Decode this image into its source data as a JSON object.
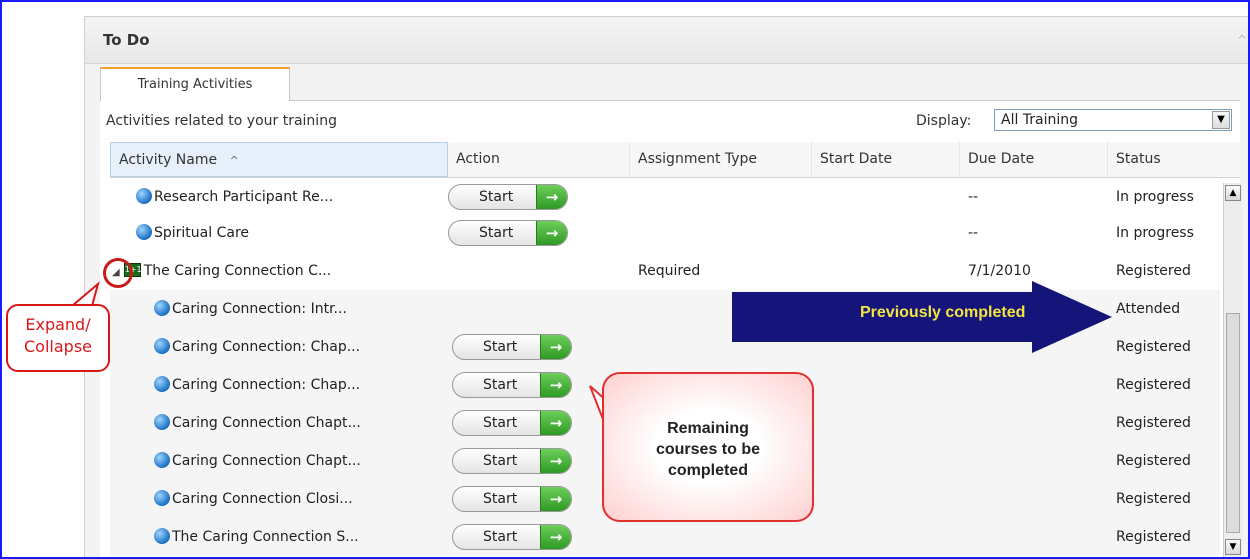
{
  "panel": {
    "title": "To Do",
    "collapse_icon": "^"
  },
  "tabs": [
    {
      "label": "Training Activities"
    }
  ],
  "toolbar": {
    "description": "Activities related to your training",
    "display_label": "Display:",
    "display_value": "All Training"
  },
  "grid": {
    "columns": [
      "Activity Name",
      "Action",
      "Assignment Type",
      "Start Date",
      "Due Date",
      "Status"
    ],
    "sort_indicator": "^",
    "rows": [
      {
        "name": "Research Participant Re...",
        "action": "Start",
        "assignment": "",
        "start": "",
        "due": "--",
        "status": "In progress",
        "icon": "globe-icon",
        "level": 0
      },
      {
        "name": "Spiritual Care",
        "action": "Start",
        "assignment": "",
        "start": "",
        "due": "--",
        "status": "In progress",
        "icon": "globe-icon",
        "level": 0
      },
      {
        "name": "The Caring Connection C...",
        "action": "",
        "assignment": "Required",
        "start": "",
        "due": "7/1/2010",
        "status": "Registered",
        "icon": "curriculum-icon",
        "level": 0,
        "expander": "◢"
      },
      {
        "name": "Caring Connection: Intr...",
        "action": "",
        "assignment": "",
        "start": "",
        "due": "",
        "status": "Attended",
        "icon": "globe-icon",
        "level": 1
      },
      {
        "name": "Caring Connection: Chap...",
        "action": "Start",
        "assignment": "",
        "start": "",
        "due": "",
        "status": "Registered",
        "icon": "globe-icon",
        "level": 1
      },
      {
        "name": "Caring Connection: Chap...",
        "action": "Start",
        "assignment": "",
        "start": "",
        "due": "",
        "status": "Registered",
        "icon": "globe-icon",
        "level": 1
      },
      {
        "name": "Caring Connection Chapt...",
        "action": "Start",
        "assignment": "",
        "start": "",
        "due": "",
        "status": "Registered",
        "icon": "globe-icon",
        "level": 1
      },
      {
        "name": "Caring Connection Chapt...",
        "action": "Start",
        "assignment": "",
        "start": "",
        "due": "",
        "status": "Registered",
        "icon": "globe-icon",
        "level": 1
      },
      {
        "name": "Caring Connection Closi...",
        "action": "Start",
        "assignment": "",
        "start": "",
        "due": "",
        "status": "Registered",
        "icon": "globe-icon",
        "level": 1
      },
      {
        "name": "The Caring Connection S...",
        "action": "Start",
        "assignment": "",
        "start": "",
        "due": "",
        "status": "Registered",
        "icon": "globe-icon",
        "level": 1
      }
    ]
  },
  "annotations": {
    "expand_collapse": "Expand/\nCollapse",
    "previously_completed": "Previously completed",
    "remaining": "Remaining\ncourses to be\ncompleted"
  },
  "colors": {
    "arrow": "#14147a",
    "arrow_text": "#f4e441",
    "callout_border": "#d81818",
    "start_arrow": "#3fae33",
    "tab_accent": "#f0a030"
  },
  "icons": {
    "action_arrow": "→",
    "curriculum": "1+1"
  }
}
